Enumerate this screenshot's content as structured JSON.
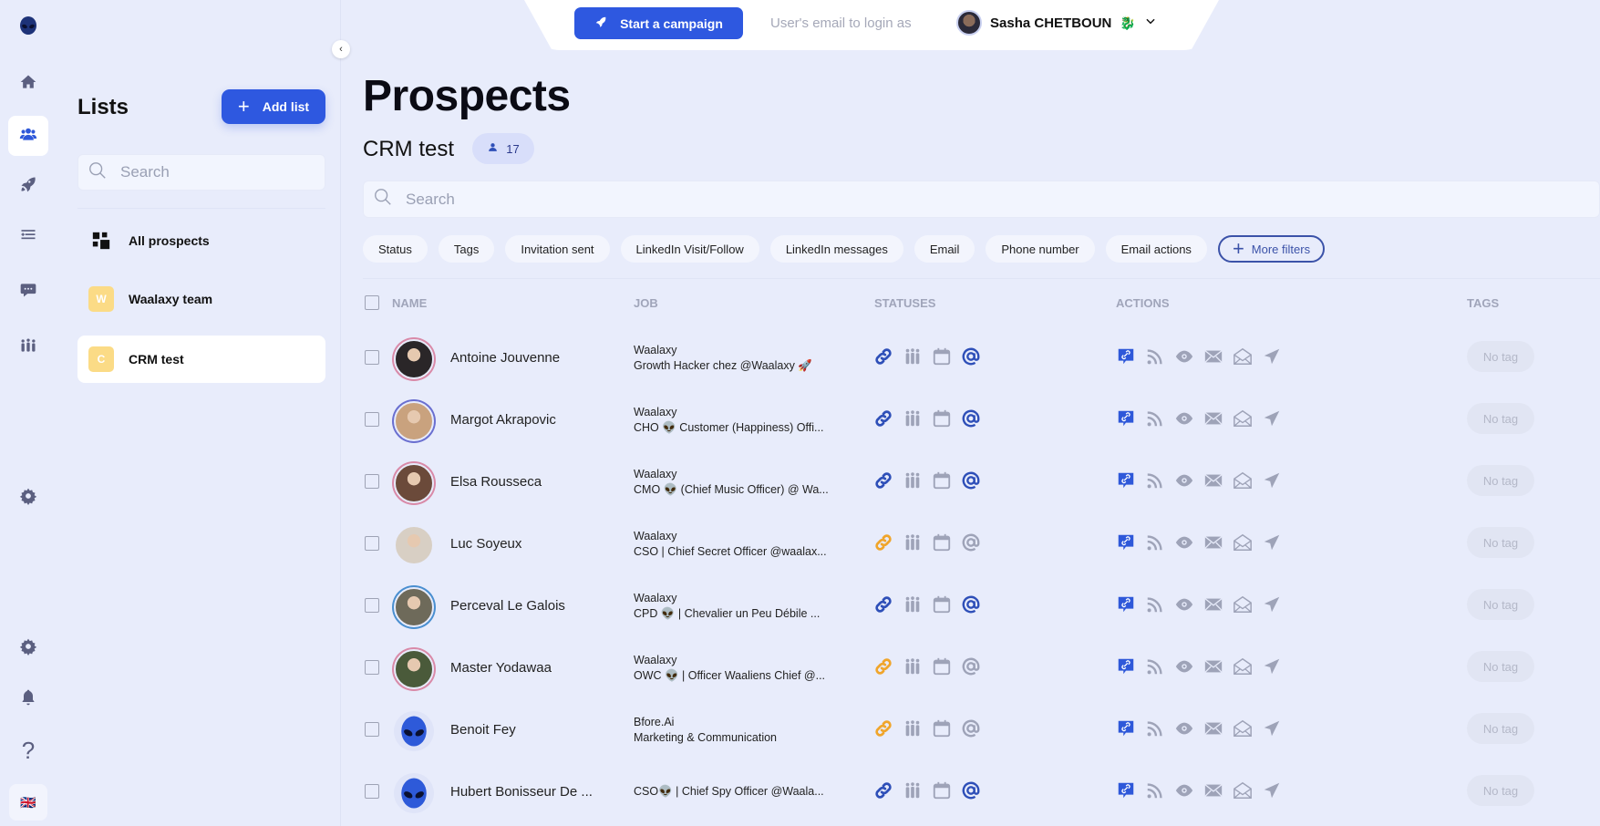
{
  "topbar": {
    "start_campaign_label": "Start a campaign",
    "login_as_placeholder": "User's email to login as",
    "user_name": "Sasha CHETBOUN",
    "user_emoji": "🐉"
  },
  "rail": {
    "items": [
      "home",
      "prospects",
      "campaigns",
      "sequences",
      "inbox",
      "team",
      "settings"
    ],
    "bottom_items": [
      "settings",
      "notifications",
      "help",
      "language"
    ],
    "language_flag": "🇬🇧"
  },
  "lists_panel": {
    "title": "Lists",
    "add_list_label": "Add list",
    "search_placeholder": "Search",
    "items": [
      {
        "label": "All prospects",
        "badge": ""
      },
      {
        "label": "Waalaxy team",
        "badge": "W"
      },
      {
        "label": "CRM test",
        "badge": "C",
        "active": true
      }
    ]
  },
  "main": {
    "title": "Prospects",
    "list_name": "CRM test",
    "prospect_count": "17",
    "search_placeholder": "Search",
    "filters": [
      "Status",
      "Tags",
      "Invitation sent",
      "LinkedIn Visit/Follow",
      "LinkedIn messages",
      "Email",
      "Phone number",
      "Email actions"
    ],
    "more_filters_label": "More filters",
    "columns": {
      "name": "NAME",
      "job": "JOB",
      "statuses": "STATUSES",
      "actions": "ACTIONS",
      "tags": "TAGS"
    },
    "rows": [
      {
        "name": "Antoine Jouvenne",
        "company": "Waalaxy",
        "title": "Growth Hacker chez @Waalaxy 🚀",
        "link_status": "connected",
        "email_status": "found",
        "tag": "No tag",
        "avatar_ring": "#d98aa8",
        "avatar_fill": "#2a2628"
      },
      {
        "name": "Margot Akrapovic",
        "company": "Waalaxy",
        "title": "CHO 👽 Customer (Happiness) Offi...",
        "link_status": "connected",
        "email_status": "found",
        "tag": "No tag",
        "avatar_ring": "#6a6fd0",
        "avatar_fill": "#c9a27e"
      },
      {
        "name": "Elsa Rousseca",
        "company": "Waalaxy",
        "title": "CMO 👽 (Chief Music Officer) @ Wa...",
        "link_status": "connected",
        "email_status": "found",
        "tag": "No tag",
        "avatar_ring": "#d98aa8",
        "avatar_fill": "#6b4a3a"
      },
      {
        "name": "Luc Soyeux",
        "company": "Waalaxy",
        "title": "CSO | Chief Secret Officer @waalax...",
        "link_status": "pending",
        "email_status": "none",
        "tag": "No tag",
        "avatar_ring": "#e8ecfb",
        "avatar_fill": "#d8cfc4"
      },
      {
        "name": "Perceval Le Galois",
        "company": "Waalaxy",
        "title": "CPD 👽 | Chevalier un Peu Débile ...",
        "link_status": "connected",
        "email_status": "found",
        "tag": "No tag",
        "avatar_ring": "#4a8fd0",
        "avatar_fill": "#6e6a5a"
      },
      {
        "name": "Master Yodawaa",
        "company": "Waalaxy",
        "title": "OWC 👽 | Officer Waaliens Chief @...",
        "link_status": "pending",
        "email_status": "none",
        "tag": "No tag",
        "avatar_ring": "#d98aa8",
        "avatar_fill": "#4a5a3a"
      },
      {
        "name": "Benoit Fey",
        "company": "Bfore.Ai",
        "title": "Marketing & Communication",
        "link_status": "pending",
        "email_status": "none",
        "tag": "No tag",
        "avatar_ring": "#e8ecfb",
        "avatar_fill": "alien"
      },
      {
        "name": "Hubert Bonisseur De ...",
        "company": "",
        "title": "CSO👽 | Chief Spy Officer @Waala...",
        "link_status": "connected",
        "email_status": "found",
        "tag": "No tag",
        "avatar_ring": "#e8ecfb",
        "avatar_fill": "alien"
      }
    ]
  },
  "colors": {
    "accent": "#2e58e0",
    "link_connected": "#2e4fb8",
    "link_pending": "#f0a52b",
    "icon_muted": "#9ea3b8",
    "background": "#e8ecfb"
  }
}
